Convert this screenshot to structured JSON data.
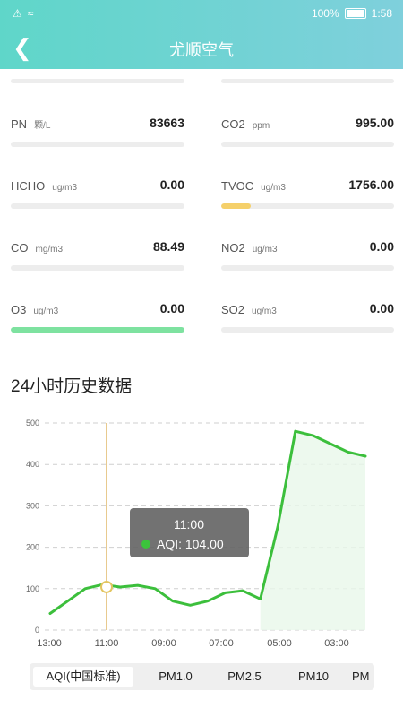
{
  "status_bar": {
    "battery": "100%",
    "time": "1:58"
  },
  "header": {
    "title": "尤顺空气",
    "back_icon": "back-arrow-icon"
  },
  "metrics": [
    {
      "name": "PN",
      "unit": "颗/L",
      "value": "83663",
      "level": 0,
      "color": "#ededed"
    },
    {
      "name": "CO2",
      "unit": "ppm",
      "value": "995.00",
      "level": 0,
      "color": "#ededed"
    },
    {
      "name": "HCHO",
      "unit": "ug/m3",
      "value": "0.00",
      "level": 0,
      "color": "#ededed"
    },
    {
      "name": "TVOC",
      "unit": "ug/m3",
      "value": "1756.00",
      "level": 0.17,
      "color": "#f5d06a"
    },
    {
      "name": "CO",
      "unit": "mg/m3",
      "value": "88.49",
      "level": 0,
      "color": "#ededed"
    },
    {
      "name": "NO2",
      "unit": "ug/m3",
      "value": "0.00",
      "level": 0,
      "color": "#ededed"
    },
    {
      "name": "O3",
      "unit": "ug/m3",
      "value": "0.00",
      "level": 1.0,
      "color": "#7ee2a0"
    },
    {
      "name": "SO2",
      "unit": "ug/m3",
      "value": "0.00",
      "level": 0,
      "color": "#ededed"
    }
  ],
  "history": {
    "title": "24小时历史数据",
    "tooltip": {
      "time": "11:00",
      "label": "AQI: 104.00"
    }
  },
  "chart_data": {
    "type": "line",
    "x_tick_labels": [
      "13:00",
      "11:00",
      "09:00",
      "07:00",
      "05:00",
      "03:00"
    ],
    "y_tick_labels": [
      "0",
      "100",
      "200",
      "300",
      "400",
      "500"
    ],
    "ylim": [
      0,
      500
    ],
    "series": [
      {
        "values": [
          40,
          70,
          100,
          110,
          104,
          108,
          100,
          70,
          60,
          70,
          90,
          95,
          75,
          250,
          480,
          470,
          450,
          430,
          420
        ]
      }
    ],
    "highlight": {
      "x": "11:00",
      "y": 104
    },
    "line_color": "#3cbf3c"
  },
  "tabs": [
    {
      "label": "AQI(中国标准)",
      "active": true
    },
    {
      "label": "PM1.0",
      "active": false
    },
    {
      "label": "PM2.5",
      "active": false
    },
    {
      "label": "PM10",
      "active": false
    },
    {
      "label": "PM",
      "active": false
    }
  ]
}
